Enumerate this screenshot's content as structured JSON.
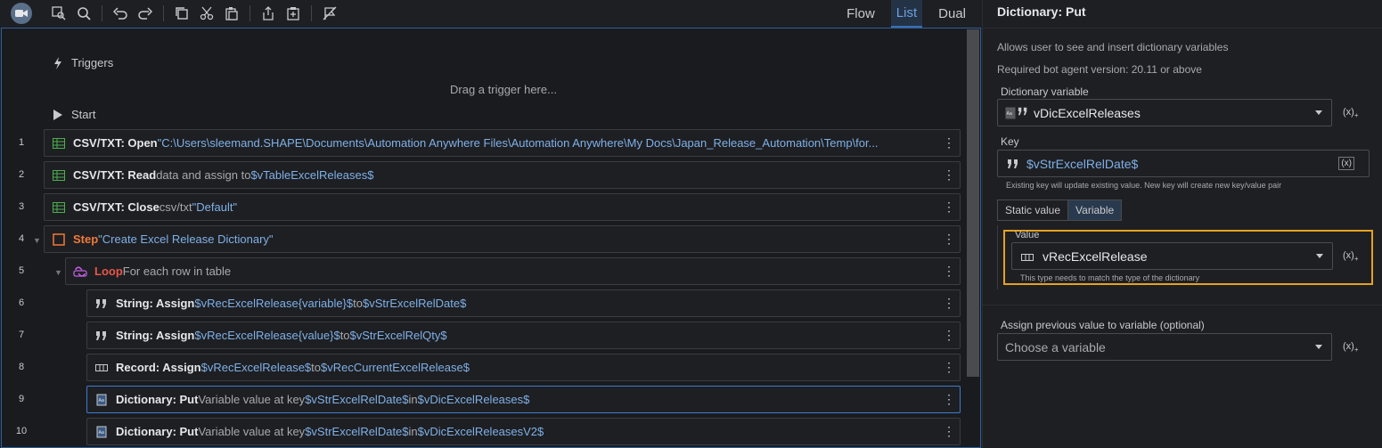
{
  "toolbar": {
    "views": [
      "Flow",
      "List",
      "Dual"
    ],
    "active_view": "List"
  },
  "canvas": {
    "triggers_label": "Triggers",
    "drag_hint": "Drag a trigger here...",
    "start_label": "Start"
  },
  "rows": [
    {
      "n": "1",
      "cmd": "CSV/TXT: Open",
      "rest": " \"C:\\Users\\sleemand.SHAPE\\Documents\\Automation Anywhere Files\\Automation Anywhere\\My Docs\\Japan_Release_Automation\\Temp\\for..."
    },
    {
      "n": "2",
      "cmd": "CSV/TXT: Read",
      "txt": " data and assign to ",
      "val": "$vTableExcelReleases$"
    },
    {
      "n": "3",
      "cmd": "CSV/TXT: Close",
      "txt": " csv/txt ",
      "val": "\"Default\""
    },
    {
      "n": "4",
      "cmd": "Step",
      "val": " \"Create Excel Release Dictionary\""
    },
    {
      "n": "5",
      "cmd": "Loop",
      "txt": " For each row in table"
    },
    {
      "n": "6",
      "cmd": "String: Assign",
      "a": " $vRecExcelRelease{variable}$",
      "b": " to ",
      "c": "$vStrExcelRelDate$"
    },
    {
      "n": "7",
      "cmd": "String: Assign",
      "a": " $vRecExcelRelease{value}$",
      "b": " to ",
      "c": "$vStrExcelRelQty$"
    },
    {
      "n": "8",
      "cmd": "Record: Assign",
      "a": " $vRecExcelRelease$",
      "b": " to ",
      "c": "$vRecCurrentExcelRelease$"
    },
    {
      "n": "9",
      "cmd": "Dictionary: Put",
      "t1": " Variable value at key ",
      "a": "$vStrExcelRelDate$",
      "b": " in ",
      "c": "$vDicExcelReleases$"
    },
    {
      "n": "10",
      "cmd": "Dictionary: Put",
      "t1": " Variable value at key ",
      "a": "$vStrExcelRelDate$",
      "b": " in ",
      "c": "$vDicExcelReleasesV2$"
    }
  ],
  "panel": {
    "title": "Dictionary: Put",
    "desc1": "Allows user to see and insert dictionary variables",
    "desc2": "Required bot agent version: 20.11 or above",
    "dict_label": "Dictionary variable",
    "dict_value": "vDicExcelReleases",
    "key_label": "Key",
    "key_value": "$vStrExcelRelDate$",
    "key_hint": "Existing key will update existing value. New key will create new key/value pair",
    "seg_static": "Static value",
    "seg_variable": "Variable",
    "value_label": "Value",
    "value_value": "vRecExcelRelease",
    "value_hint": "This type needs to match the type of the dictionary",
    "assign_label": "Assign previous value to variable (optional)",
    "assign_placeholder": "Choose a variable",
    "fx_text": "(x)"
  }
}
